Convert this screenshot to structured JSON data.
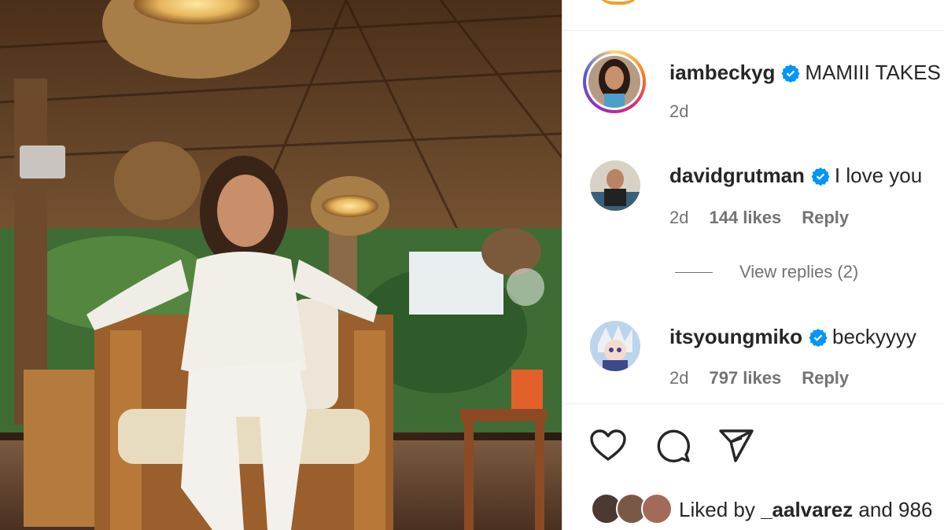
{
  "post": {
    "author": "iambeckyg",
    "caption": "MAMIII TAKES",
    "time": "2d"
  },
  "comments": [
    {
      "username": "davidgrutman",
      "text": "I love you",
      "time": "2d",
      "likes": "144 likes",
      "reply": "Reply"
    },
    {
      "username": "itsyoungmiko",
      "text": "beckyyyy",
      "time": "2d",
      "likes": "797 likes",
      "reply": "Reply"
    }
  ],
  "view_replies": "View replies (2)",
  "liked_by": {
    "prefix": "Liked by",
    "user": "_aalvarez",
    "suffix": "and 986"
  },
  "icons": [
    "heart-icon",
    "comment-icon",
    "share-icon",
    "verified-icon"
  ],
  "colors": {
    "verified": "#0095f6",
    "text": "#262626",
    "secondary": "#737373"
  }
}
